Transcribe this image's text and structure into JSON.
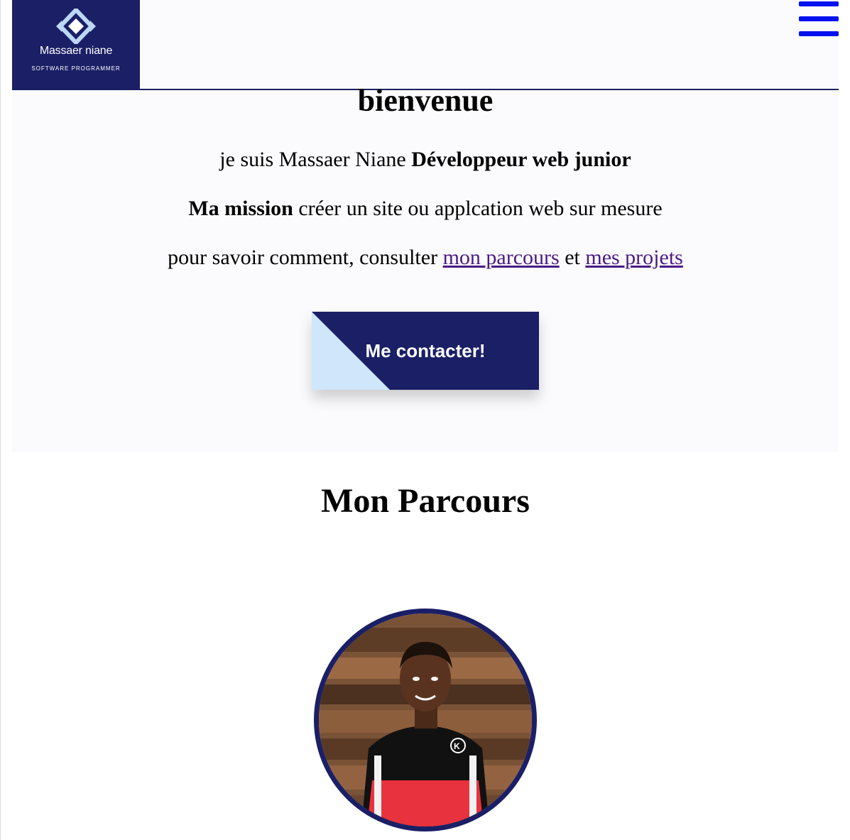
{
  "header": {
    "logo": {
      "name": "Massaer niane",
      "tagline": "SOFTWARE PROGRAMMER",
      "icon": "diamond-logo-icon"
    },
    "menu_icon": "hamburger-menu-icon",
    "colors": {
      "brand": "#1a1f66",
      "menu": "#0010ee"
    }
  },
  "hero": {
    "title": "bienvenue",
    "intro": {
      "prefix": "je suis Massaer Niane ",
      "role": "Développeur web junior"
    },
    "mission": {
      "label": "Ma mission",
      "text": " créer un site ou applcation web sur mesure"
    },
    "links_line": {
      "prefix": "pour savoir comment, consulter ",
      "link1": "mon parcours",
      "middle": " et ",
      "link2": "mes projets"
    },
    "cta_label": "Me contacter!",
    "colors": {
      "cta_bg": "#1a1f66",
      "cta_accent": "#cfe6fb",
      "link": "#4b1a86"
    }
  },
  "parcours": {
    "title": "Mon Parcours",
    "avatar": "profile-photo"
  }
}
